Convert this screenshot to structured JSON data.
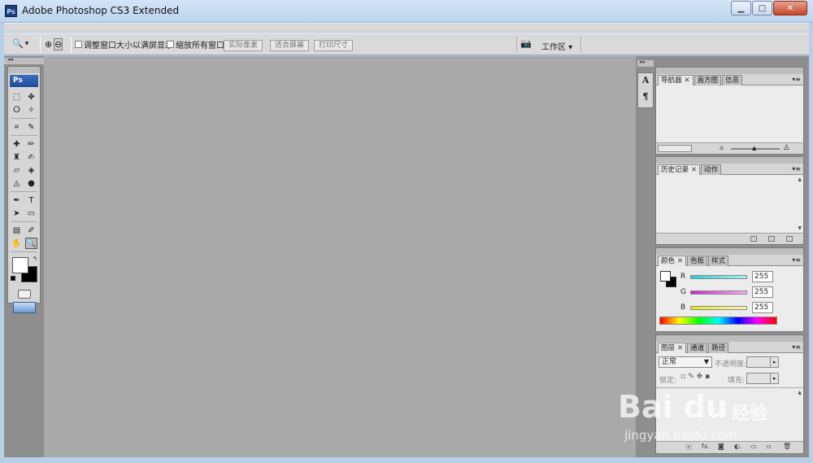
{
  "window": {
    "app_icon": "Ps",
    "title": "Adobe Photoshop CS3 Extended",
    "min_icon": "▁",
    "max_icon": "□",
    "close_icon": "✕"
  },
  "options_bar": {
    "tool_icon": "🔍",
    "tool_arrow": "▾",
    "zoom_in_icon": "⊕",
    "zoom_out_icon": "⊖",
    "resize_windows_label": "调整窗口大小以满屏显示",
    "zoom_all_label": "缩放所有窗口",
    "actual_pixels": "实际像素",
    "fit_screen": "适合屏幕",
    "print_size": "打印尺寸",
    "camera_icon": "📷",
    "workspace_label": "工作区 ▾"
  },
  "toolbox": {
    "logo": "Ps",
    "collapse": "◂◂",
    "rows": [
      [
        "⬚",
        "✥"
      ],
      [
        "ⵔ",
        "✧"
      ],
      [
        "⌗",
        "✎"
      ],
      [
        "✚",
        "✏"
      ],
      [
        "♜",
        "✍"
      ],
      [
        "▱",
        "◈"
      ],
      [
        "◬",
        "●"
      ],
      [
        "✒",
        "T"
      ],
      [
        "➤",
        "▭"
      ],
      [
        "▤",
        "✐"
      ],
      [
        "✋",
        "🔍"
      ]
    ]
  },
  "dock_icons": {
    "collapse": "▸▸",
    "char": "A",
    "para": "¶"
  },
  "panels": {
    "navigator": {
      "tabs": [
        "导航器",
        "直方图",
        "信息"
      ],
      "menu": "▾≡"
    },
    "history": {
      "tabs": [
        "历史记录",
        "动作"
      ],
      "menu": "▾≡"
    },
    "color": {
      "tabs": [
        "颜色",
        "色板",
        "样式"
      ],
      "menu": "▾≡",
      "channels": [
        {
          "label": "R",
          "value": "255",
          "color": "#22d3d3"
        },
        {
          "label": "G",
          "value": "255",
          "color": "#d322d3"
        },
        {
          "label": "B",
          "value": "255",
          "color": "#e6e622"
        }
      ]
    },
    "layers": {
      "tabs": [
        "图层",
        "通道",
        "路径"
      ],
      "menu": "▾≡",
      "blend_mode": "正常",
      "opacity_label": "不透明度:",
      "lock_label": "锁定:",
      "fill_label": "填充:",
      "footer_icons": [
        "ⓔ",
        "fx.",
        "◙",
        "◐.",
        "▭",
        "▫",
        "🗑"
      ]
    }
  },
  "watermark": {
    "brand": "Bai du",
    "cn": "经验",
    "url": "jingyan.baidu.com"
  }
}
